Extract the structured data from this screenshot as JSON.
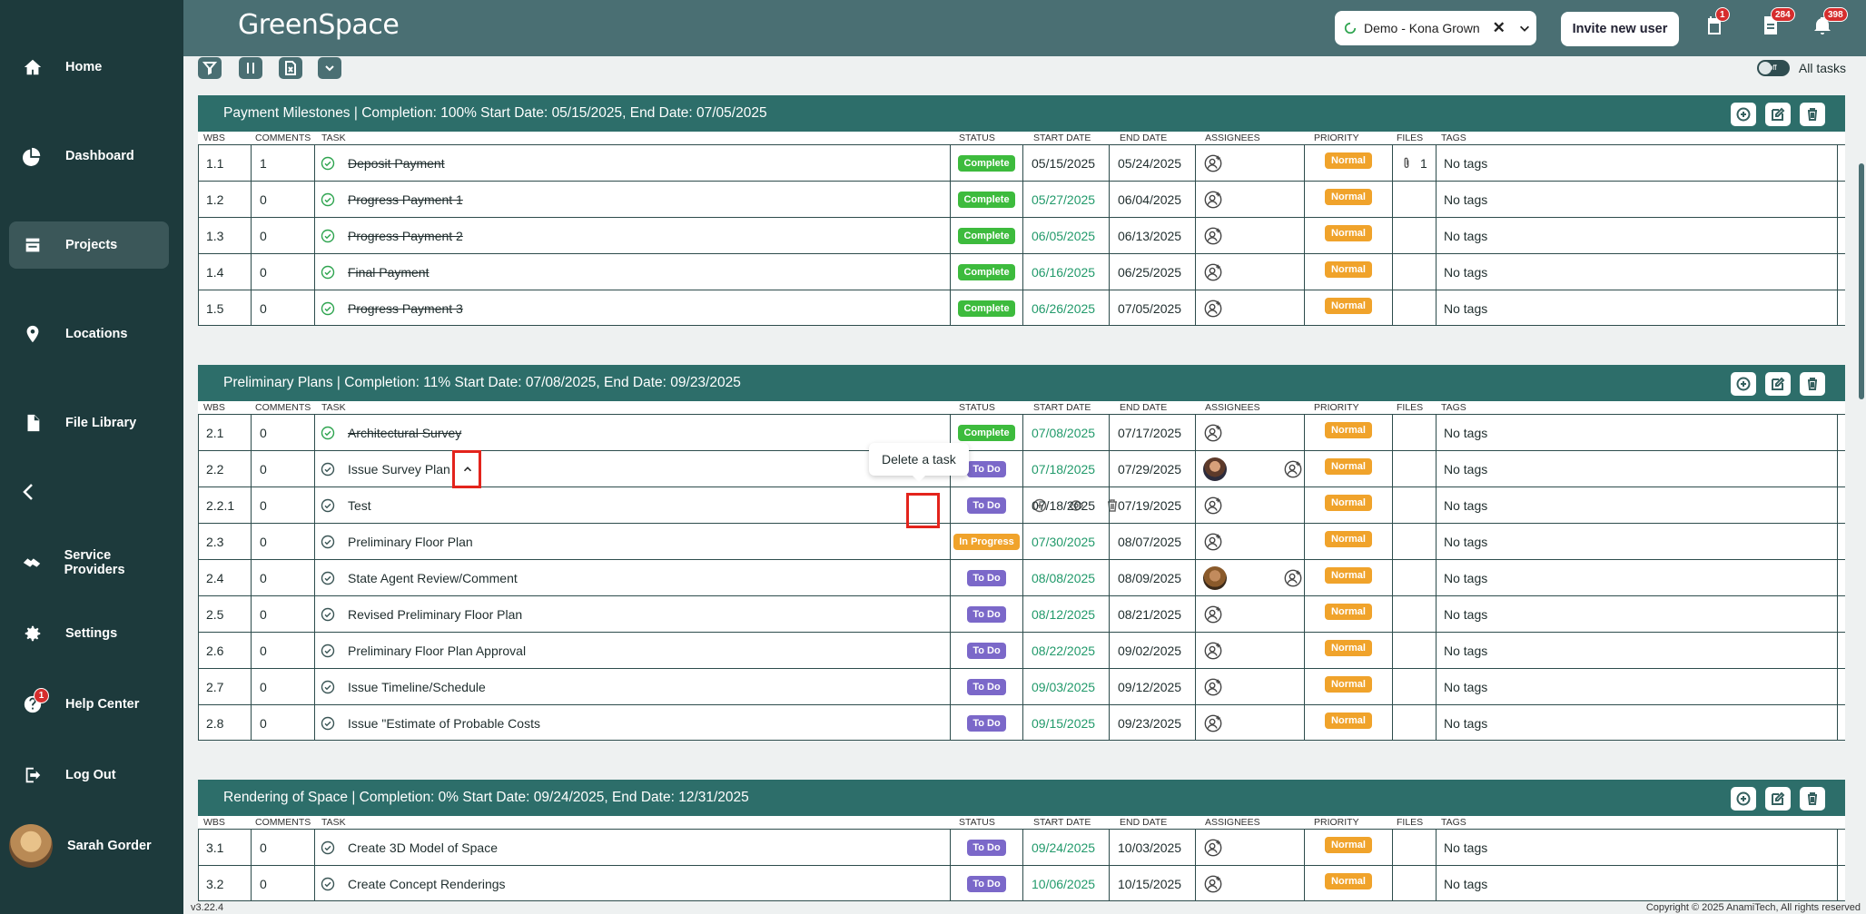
{
  "app": {
    "logo": "GreenSpace",
    "version": "v3.22.4",
    "copyright": "Copyright © 2025 AnamiTech, All rights reserved"
  },
  "sidebar": {
    "items": [
      {
        "label": "Home",
        "icon": "home-icon"
      },
      {
        "label": "Dashboard",
        "icon": "dashboard-icon"
      },
      {
        "label": "Projects",
        "icon": "projects-icon",
        "active": true
      },
      {
        "label": "Locations",
        "icon": "location-icon"
      },
      {
        "label": "File Library",
        "icon": "file-icon"
      },
      {
        "label": "Service Providers",
        "icon": "handshake-icon"
      },
      {
        "label": "Settings",
        "icon": "gear-icon"
      },
      {
        "label": "Help Center",
        "icon": "help-icon",
        "badge": "1"
      },
      {
        "label": "Log Out",
        "icon": "logout-icon"
      }
    ],
    "user_name": "Sarah Gorder"
  },
  "header": {
    "client": "Demo - Kona Grown",
    "invite_label": "Invite new user",
    "badges": {
      "calendar": "1",
      "docs": "284",
      "bell": "398"
    }
  },
  "toolbar": {
    "toggle_label": "off",
    "all_tasks_label": "All tasks"
  },
  "columns": [
    "WBS",
    "COMMENTS",
    "TASK",
    "STATUS",
    "START DATE",
    "END DATE",
    "ASSIGNEES",
    "PRIORITY",
    "FILES",
    "TAGS"
  ],
  "groups": [
    {
      "name": "Payment Milestones",
      "summary": "| Completion: 100%  Start Date: 05/15/2025, End Date: 07/05/2025",
      "rows": [
        {
          "wbs": "1.1",
          "comments": "1",
          "task": "Deposit Payment",
          "status": "Complete",
          "start": "05/15/2025",
          "end": "05/24/2025",
          "priority": "Normal",
          "files": "1",
          "tags": "No tags"
        },
        {
          "wbs": "1.2",
          "comments": "0",
          "task": "Progress Payment 1",
          "status": "Complete",
          "start": "05/27/2025",
          "end": "06/04/2025",
          "priority": "Normal",
          "files": "",
          "tags": "No tags"
        },
        {
          "wbs": "1.3",
          "comments": "0",
          "task": "Progress Payment 2",
          "status": "Complete",
          "start": "06/05/2025",
          "end": "06/13/2025",
          "priority": "Normal",
          "files": "",
          "tags": "No tags"
        },
        {
          "wbs": "1.4",
          "comments": "0",
          "task": "Final Payment",
          "status": "Complete",
          "start": "06/16/2025",
          "end": "06/25/2025",
          "priority": "Normal",
          "files": "",
          "tags": "No tags"
        },
        {
          "wbs": "1.5",
          "comments": "0",
          "task": "Progress Payment 3",
          "status": "Complete",
          "start": "06/26/2025",
          "end": "07/05/2025",
          "priority": "Normal",
          "files": "",
          "tags": "No tags"
        }
      ]
    },
    {
      "name": "Preliminary Plans",
      "summary": "| Completion: 11%  Start Date: 07/08/2025, End Date: 09/23/2025",
      "rows": [
        {
          "wbs": "2.1",
          "comments": "0",
          "task": "Architectural Survey",
          "status": "Complete",
          "start": "07/08/2025",
          "end": "07/17/2025",
          "priority": "Normal",
          "tags": "No tags"
        },
        {
          "wbs": "2.2",
          "comments": "0",
          "task": "Issue Survey Plan",
          "status": "To Do",
          "start": "07/18/2025",
          "end": "07/29/2025",
          "priority": "Normal",
          "tags": "No tags"
        },
        {
          "wbs": "2.2.1",
          "comments": "0",
          "task": "Test",
          "status": "To Do",
          "start": "07/18/2025",
          "end": "07/19/2025",
          "priority": "Normal",
          "tags": "No tags"
        },
        {
          "wbs": "2.3",
          "comments": "0",
          "task": "Preliminary Floor Plan",
          "status": "In Progress",
          "start": "07/30/2025",
          "end": "08/07/2025",
          "priority": "Normal",
          "tags": "No tags"
        },
        {
          "wbs": "2.4",
          "comments": "0",
          "task": "State Agent Review/Comment",
          "status": "To Do",
          "start": "08/08/2025",
          "end": "08/09/2025",
          "priority": "Normal",
          "tags": "No tags"
        },
        {
          "wbs": "2.5",
          "comments": "0",
          "task": "Revised Preliminary Floor Plan",
          "status": "To Do",
          "start": "08/12/2025",
          "end": "08/21/2025",
          "priority": "Normal",
          "tags": "No tags"
        },
        {
          "wbs": "2.6",
          "comments": "0",
          "task": "Preliminary Floor Plan Approval",
          "status": "To Do",
          "start": "08/22/2025",
          "end": "09/02/2025",
          "priority": "Normal",
          "tags": "No tags"
        },
        {
          "wbs": "2.7",
          "comments": "0",
          "task": "Issue Timeline/Schedule",
          "status": "To Do",
          "start": "09/03/2025",
          "end": "09/12/2025",
          "priority": "Normal",
          "tags": "No tags"
        },
        {
          "wbs": "2.8",
          "comments": "0",
          "task": "Issue \"Estimate of Probable Costs",
          "status": "To Do",
          "start": "09/15/2025",
          "end": "09/23/2025",
          "priority": "Normal",
          "tags": "No tags"
        }
      ]
    },
    {
      "name": "Rendering of Space",
      "summary": "| Completion: 0%  Start Date: 09/24/2025, End Date: 12/31/2025",
      "rows": [
        {
          "wbs": "3.1",
          "comments": "0",
          "task": "Create 3D Model of Space",
          "status": "To Do",
          "start": "09/24/2025",
          "end": "10/03/2025",
          "priority": "Normal",
          "tags": "No tags"
        },
        {
          "wbs": "3.2",
          "comments": "0",
          "task": "Create Concept Renderings",
          "status": "To Do",
          "start": "10/06/2025",
          "end": "10/15/2025",
          "priority": "Normal",
          "tags": "No tags"
        }
      ]
    }
  ],
  "tooltip": "Delete a task"
}
